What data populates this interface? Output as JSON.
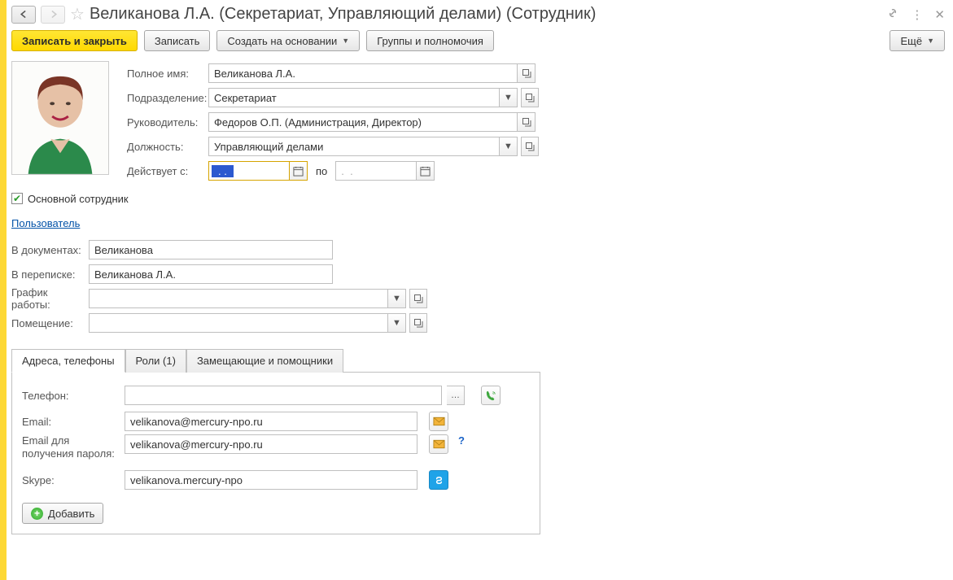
{
  "title": "Великанова Л.А. (Секретариат, Управляющий делами) (Сотрудник)",
  "toolbar": {
    "save_close": "Записать и закрыть",
    "save": "Записать",
    "create_based": "Создать на основании",
    "groups": "Группы и полномочия",
    "more": "Ещё"
  },
  "fields": {
    "full_name_label": "Полное имя:",
    "full_name_value": "Великанова Л.А.",
    "department_label": "Подразделение:",
    "department_value": "Секретариат",
    "manager_label": "Руководитель:",
    "manager_value": "Федоров О.П. (Администрация, Директор)",
    "position_label": "Должность:",
    "position_value": "Управляющий делами",
    "valid_from_label": "Действует с:",
    "valid_from_value": " .  .    ",
    "valid_to_label": "по",
    "valid_to_value": ".  .",
    "main_employee_label": "Основной сотрудник",
    "user_link": "Пользователь",
    "in_docs_label": "В документах:",
    "in_docs_value": "Великанова",
    "in_mail_label": "В переписке:",
    "in_mail_value": "Великанова Л.А.",
    "schedule_label": "График работы:",
    "schedule_value": "",
    "room_label": "Помещение:",
    "room_value": ""
  },
  "tabs": {
    "contacts": "Адреса, телефоны",
    "roles": "Роли (1)",
    "substitutes": "Замещающие и помощники"
  },
  "contacts": {
    "phone_label": "Телефон:",
    "phone_value": "",
    "email_label": "Email:",
    "email_value": "velikanova@mercury-npo.ru",
    "email_pwd_label": "Email для получения пароля:",
    "email_pwd_value": "velikanova@mercury-npo.ru",
    "skype_label": "Skype:",
    "skype_value": "velikanova.mercury-npo",
    "add_btn": "Добавить"
  }
}
